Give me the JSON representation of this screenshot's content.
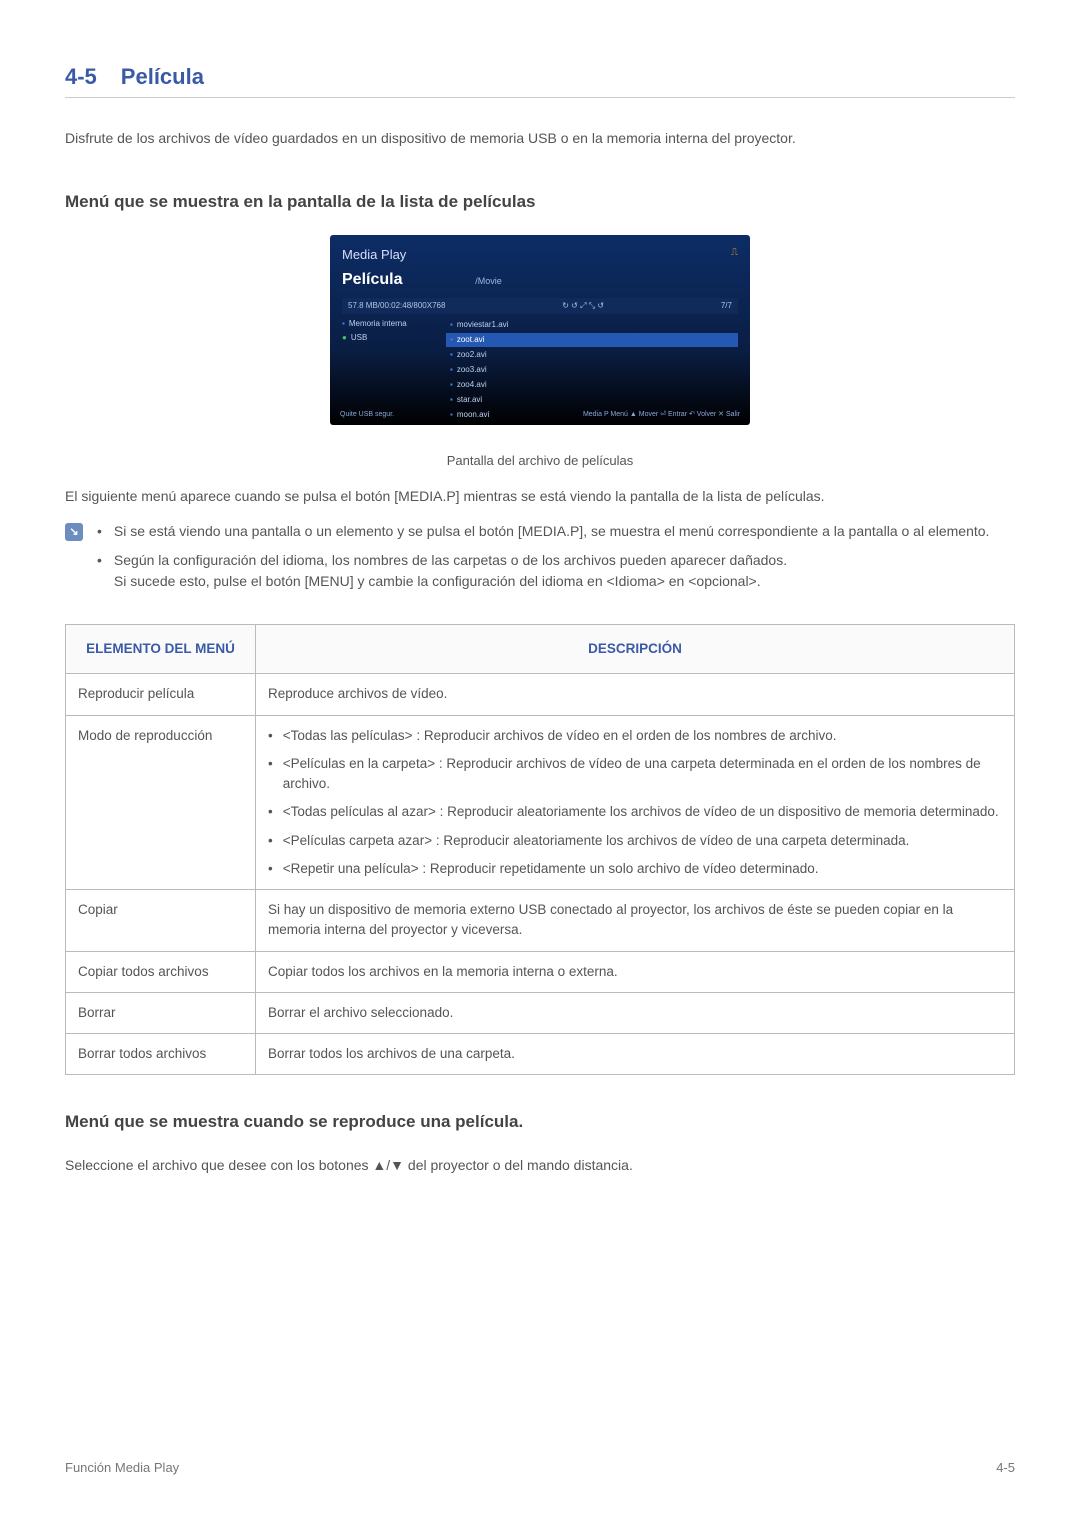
{
  "section": {
    "number": "4-5",
    "title": "Película"
  },
  "intro": "Disfrute de los archivos de vídeo guardados en un dispositivo de memoria USB o en la memoria interna del proyector.",
  "h2_list": "Menú que se muestra en la pantalla de la lista de películas",
  "screenshot": {
    "top": "Media Play",
    "title": "Película",
    "path": "/Movie",
    "bar_left": "57.8 MB/00:02:48/800X768",
    "bar_right": "7/7",
    "left_internal": "Memoria interna",
    "left_usb": "USB",
    "files": [
      "moviestar1.avi",
      "zoot.avi",
      "zoo2.avi",
      "zoo3.avi",
      "zoo4.avi",
      "star.avi",
      "moon.avi"
    ],
    "footer_left": "Quite USB segur.",
    "footer_right": "Media P  Menú  ▲ Mover  ⏎ Entrar  ↶ Volver  ✕ Salir"
  },
  "caption": "Pantalla del archivo de películas",
  "para_after_caption": "El siguiente menú aparece cuando se pulsa el botón [MEDIA.P] mientras se está viendo la pantalla de la lista de películas.",
  "notes": [
    "Si se está viendo una pantalla o un elemento y se pulsa el botón [MEDIA.P], se muestra el menú correspondiente a la pantalla o al elemento.",
    "Según la configuración del idioma, los nombres de las carpetas o de los archivos pueden aparecer dañados.\nSi sucede esto, pulse el botón [MENU] y cambie la configuración del idioma en <Idioma> en <opcional>."
  ],
  "table": {
    "header_item": "ELEMENTO DEL MENÚ",
    "header_desc": "DESCRIPCIÓN",
    "rows": [
      {
        "item": "Reproducir película",
        "desc_plain": "Reproduce archivos de vídeo."
      },
      {
        "item": "Modo de reproducción",
        "desc_list": [
          "<Todas las películas> : Reproducir archivos de vídeo en el orden de los nombres de archivo.",
          "<Películas en la carpeta> : Reproducir archivos de vídeo de una carpeta determinada en el orden de los nombres de archivo.",
          "<Todas películas al azar> : Reproducir aleatoriamente los archivos de vídeo de un dispositivo de memoria determinado.",
          "<Películas carpeta azar> : Reproducir aleatoriamente los archivos de vídeo de una carpeta determinada.",
          "<Repetir una película> : Reproducir repetidamente un solo archivo de vídeo determinado."
        ]
      },
      {
        "item": "Copiar",
        "desc_plain": "Si hay un dispositivo de memoria externo USB conectado al proyector, los archivos de éste se pueden copiar en la memoria interna del proyector y viceversa."
      },
      {
        "item": "Copiar todos archivos",
        "desc_plain": "Copiar todos los archivos en la memoria interna o externa."
      },
      {
        "item": "Borrar",
        "desc_plain": "Borrar el archivo seleccionado."
      },
      {
        "item": "Borrar todos archivos",
        "desc_plain": "Borrar todos los archivos de una carpeta."
      }
    ]
  },
  "h2_play": "Menú que se muestra cuando se reproduce una película.",
  "para_play": "Seleccione el archivo que desee con los botones ▲/▼ del proyector o del mando distancia.",
  "footer_left": "Función Media Play",
  "footer_right": "4-5"
}
